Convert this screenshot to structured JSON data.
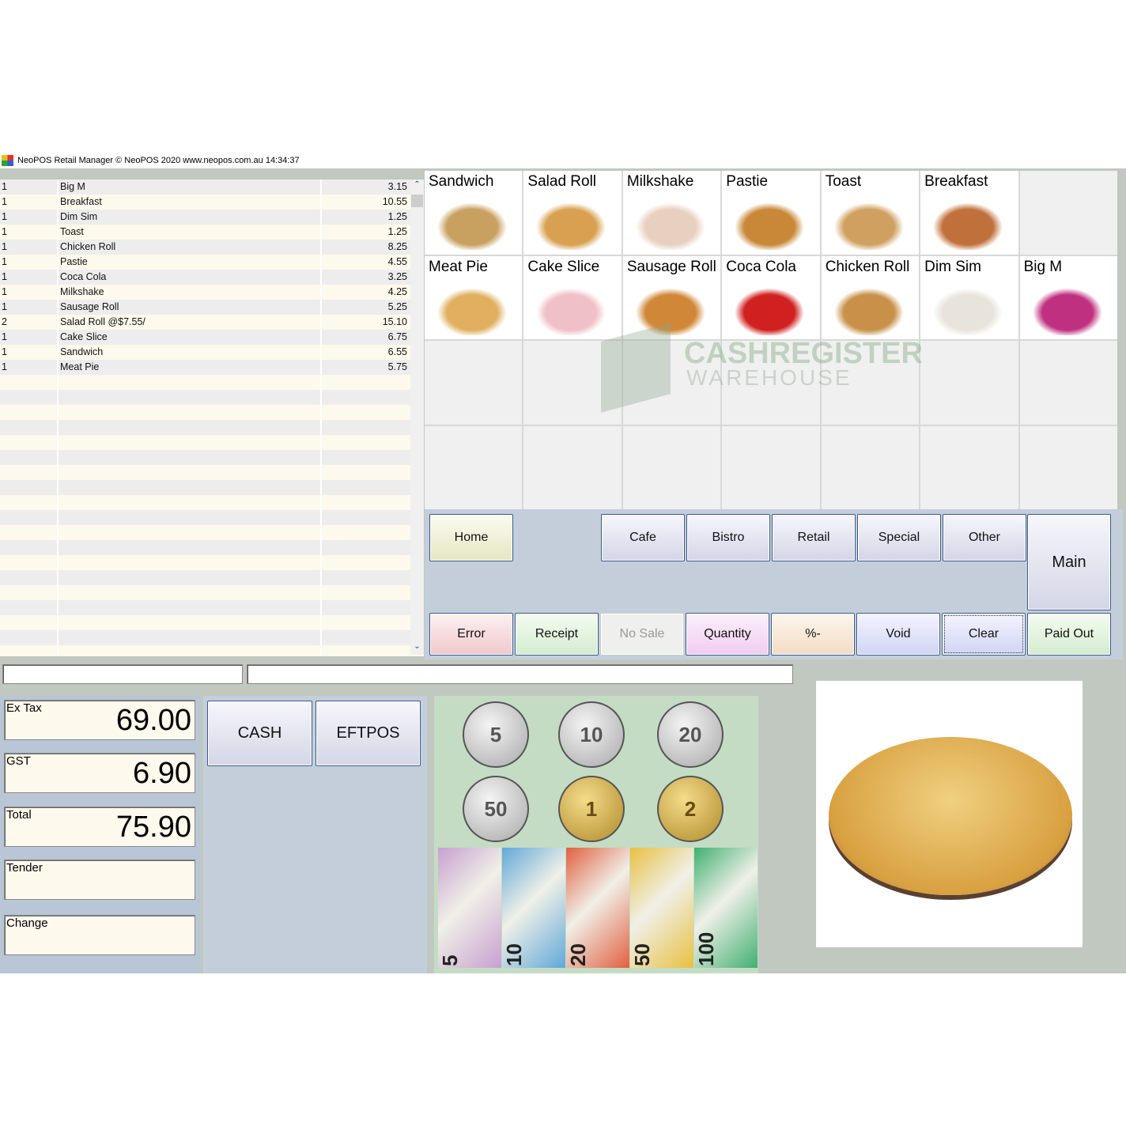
{
  "window": {
    "title": "NeoPOS Retail Manager  © NeoPOS 2020  www.neopos.com.au  14:34:37"
  },
  "order": [
    {
      "qty": "1",
      "name": "Big M",
      "price": "3.15"
    },
    {
      "qty": "1",
      "name": "Breakfast",
      "price": "10.55"
    },
    {
      "qty": "1",
      "name": "Dim Sim",
      "price": "1.25"
    },
    {
      "qty": "1",
      "name": "Toast",
      "price": "1.25"
    },
    {
      "qty": "1",
      "name": "Chicken Roll",
      "price": "8.25"
    },
    {
      "qty": "1",
      "name": "Pastie",
      "price": "4.55"
    },
    {
      "qty": "1",
      "name": "Coca Cola",
      "price": "3.25"
    },
    {
      "qty": "1",
      "name": "Milkshake",
      "price": "4.25"
    },
    {
      "qty": "1",
      "name": "Sausage Roll",
      "price": "5.25"
    },
    {
      "qty": "2",
      "name": "Salad Roll @$7.55/",
      "price": "15.10"
    },
    {
      "qty": "1",
      "name": "Cake Slice",
      "price": "6.75"
    },
    {
      "qty": "1",
      "name": "Sandwich",
      "price": "6.55"
    },
    {
      "qty": "1",
      "name": "Meat Pie",
      "price": "5.75"
    }
  ],
  "products": [
    {
      "label": "Sandwich",
      "color": "#c8a060"
    },
    {
      "label": "Salad Roll",
      "color": "#d8a050"
    },
    {
      "label": "Milkshake",
      "color": "#e8d0c0"
    },
    {
      "label": "Pastie",
      "color": "#c88838"
    },
    {
      "label": "Toast",
      "color": "#d0a060"
    },
    {
      "label": "Breakfast",
      "color": "#c0703a"
    },
    {
      "label": "",
      "color": ""
    },
    {
      "label": "Meat Pie",
      "color": "#e0b060"
    },
    {
      "label": "Cake Slice",
      "color": "#f0c0c8"
    },
    {
      "label": "Sausage Roll",
      "color": "#d08838"
    },
    {
      "label": "Coca Cola",
      "color": "#d02020"
    },
    {
      "label": "Chicken Roll",
      "color": "#c89048"
    },
    {
      "label": "Dim Sim",
      "color": "#e8e4dc"
    },
    {
      "label": "Big M",
      "color": "#c03080"
    }
  ],
  "watermark": {
    "line1": "CASHREGISTER",
    "line2": "WAREHOUSE"
  },
  "buttons": {
    "home": "Home",
    "cafe": "Cafe",
    "bistro": "Bistro",
    "retail": "Retail",
    "special": "Special",
    "other": "Other",
    "main": "Main",
    "error": "Error",
    "receipt": "Receipt",
    "no_sale": "No Sale",
    "quantity": "Quantity",
    "percent": "%-",
    "void": "Void",
    "clear": "Clear",
    "paid_out": "Paid Out",
    "cash": "CASH",
    "eftpos": "EFTPOS"
  },
  "totals": {
    "ex_tax_label": "Ex Tax",
    "ex_tax": "69.00",
    "gst_label": "GST",
    "gst": "6.90",
    "total_label": "Total",
    "total": "75.90",
    "tender_label": "Tender",
    "tender": "",
    "change_label": "Change",
    "change": ""
  },
  "coins": [
    "5",
    "10",
    "20",
    "50",
    "1",
    "2"
  ],
  "notes": [
    "5",
    "10",
    "20",
    "50",
    "100"
  ],
  "colors": {
    "note5": "#c8a0d0",
    "note10": "#60a8d8",
    "note20": "#e06040",
    "note50": "#e8c040",
    "note100": "#40b070"
  }
}
